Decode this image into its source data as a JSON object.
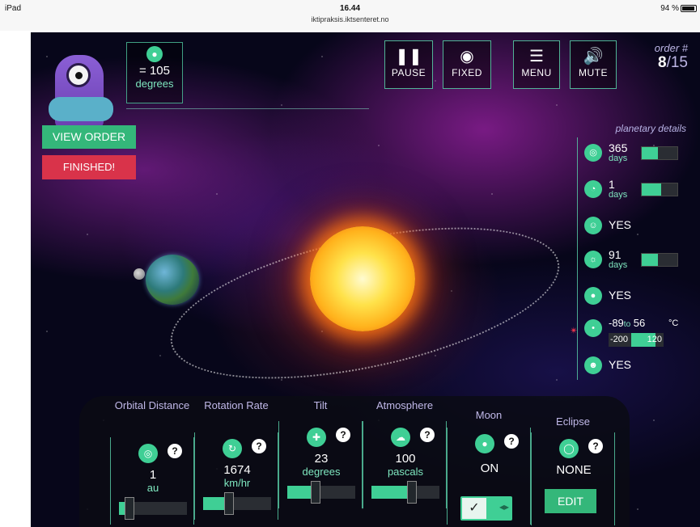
{
  "statusbar": {
    "device": "iPad",
    "time": "16.44",
    "url": "iktipraksis.iktsenteret.no",
    "battery": "94 %",
    "battery_level": 0.94
  },
  "temperature": {
    "value": "= 105",
    "unit": "degrees"
  },
  "buttons": {
    "view_order": "VIEW ORDER",
    "finished": "FINISHED!"
  },
  "top_controls": [
    {
      "name": "pause",
      "label": "PAUSE",
      "icon": "pause-icon"
    },
    {
      "name": "fixed",
      "label": "FIXED",
      "icon": "camera-icon"
    },
    {
      "name": "menu",
      "label": "MENU",
      "icon": "menu-icon"
    },
    {
      "name": "mute",
      "label": "MUTE",
      "icon": "speaker-icon"
    }
  ],
  "order": {
    "title": "order #",
    "current": "8",
    "total": "/15"
  },
  "planetary_details": {
    "title": "planetary details",
    "rows": [
      {
        "value": "365",
        "unit": "days",
        "fill": 0.45,
        "icon": "orbit-icon"
      },
      {
        "value": "1",
        "unit": "days",
        "fill": 0.55,
        "icon": "rotation-icon"
      },
      {
        "value": "YES",
        "icon": "moon-face-icon"
      },
      {
        "value": "91",
        "unit": "days",
        "fill": 0.45,
        "icon": "season-icon"
      },
      {
        "value": "YES",
        "icon": "water-drop-icon"
      },
      {
        "temp_low": "-89",
        "temp_to": "to",
        "temp_high": "56",
        "temp_unit": "°C",
        "range_low": "-200",
        "range_high": "120",
        "icon": "thermometer-icon"
      },
      {
        "value": "YES",
        "icon": "life-face-icon"
      }
    ]
  },
  "controls": [
    {
      "title": "Orbital Distance",
      "value": "1",
      "unit": "au",
      "fill": 0.16,
      "icon": "orbit-icon"
    },
    {
      "title": "Rotation Rate",
      "value": "1674",
      "unit": "km/hr",
      "fill": 0.38,
      "icon": "rotation-icon"
    },
    {
      "title": "Tilt",
      "value": "23",
      "unit": "degrees",
      "fill": 0.42,
      "icon": "tilt-icon"
    },
    {
      "title": "Atmosphere",
      "value": "100",
      "unit": "pascals",
      "fill": 0.6,
      "icon": "cloud-icon"
    },
    {
      "title": "Moon",
      "value": "ON",
      "icon": "moon-icon"
    },
    {
      "title": "Eclipse",
      "value": "NONE",
      "edit": "EDIT",
      "icon": "eclipse-icon"
    }
  ]
}
